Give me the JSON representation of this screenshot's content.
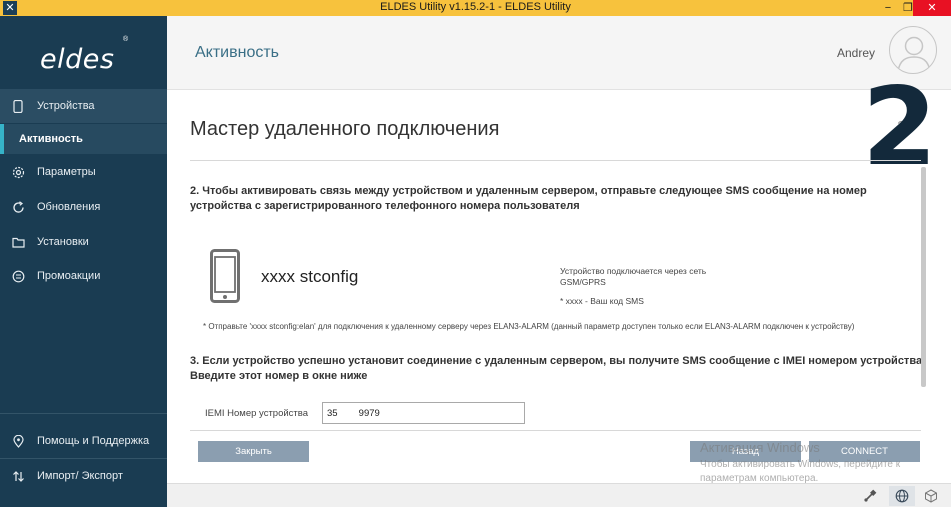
{
  "window": {
    "title": "ELDES Utility v1.15.2-1 - ELDES Utility",
    "app_icon": "eldes-app-icon",
    "controls": {
      "minimize": "−",
      "maximize": "❐",
      "close": "✕"
    }
  },
  "sidebar": {
    "logo": "eldes",
    "logo_mark": "®",
    "items": [
      {
        "label": "Устройства",
        "icon": "phone-icon"
      },
      {
        "label": "Активность"
      },
      {
        "label": "Параметры",
        "icon": "gear-icon"
      },
      {
        "label": "Обновления",
        "icon": "refresh-icon"
      },
      {
        "label": "Установки",
        "icon": "folder-icon"
      },
      {
        "label": "Промоакции",
        "icon": "promo-icon"
      }
    ],
    "bottom_items": [
      {
        "label": "Помощь и Поддержка",
        "icon": "location-pin-icon"
      },
      {
        "label": "Импорт/ Экспорт",
        "icon": "import-export-icon"
      }
    ]
  },
  "header": {
    "title": "Активность",
    "user": "Andrey"
  },
  "wizard": {
    "title": "Мастер удаленного подключения",
    "step": "2",
    "step_total_fragment": "2",
    "step2_text": "2. Чтобы активировать связь между устройством и удаленным сервером, отправьте следующее SMS сообщение на номер устройства с зарегистрированного телефонного номера пользователя",
    "sms_code": "xxxx stconfig",
    "note_network_line1": "Устройство подключается через сеть",
    "note_network_line2": "GSM/GPRS",
    "note_code": "* xxxx - Ваш код SMS",
    "footnote": "* Отправьте 'xxxx stconfig:elan' для подключения к удаленному серверу через ELAN3-ALARM (данный параметр доступен только если ELAN3-ALARM подключен к устройству)",
    "step3_text": "3. Если устройство успешно установит соединение с удаленным сервером, вы получите SMS сообщение с IMEI номером устройства. Введите этот номер в окне ниже",
    "imei_label": "IEMI Номер устройства",
    "imei_value": "35        9979"
  },
  "buttons": {
    "close": "Закрыть",
    "back": "Назад",
    "connect": "CONNECT"
  },
  "watermark": {
    "line1": "Активация Windows",
    "line2": "Чтобы активировать Windows, перейдите к параметрам компьютера."
  },
  "statusbar": {
    "icons": [
      "usb-icon",
      "globe-icon",
      "box-icon"
    ]
  },
  "colors": {
    "titlebar": "#f7c23d",
    "sidebar": "#1a3c52",
    "accent": "#36b3c8",
    "button": "#8b9eb0"
  }
}
